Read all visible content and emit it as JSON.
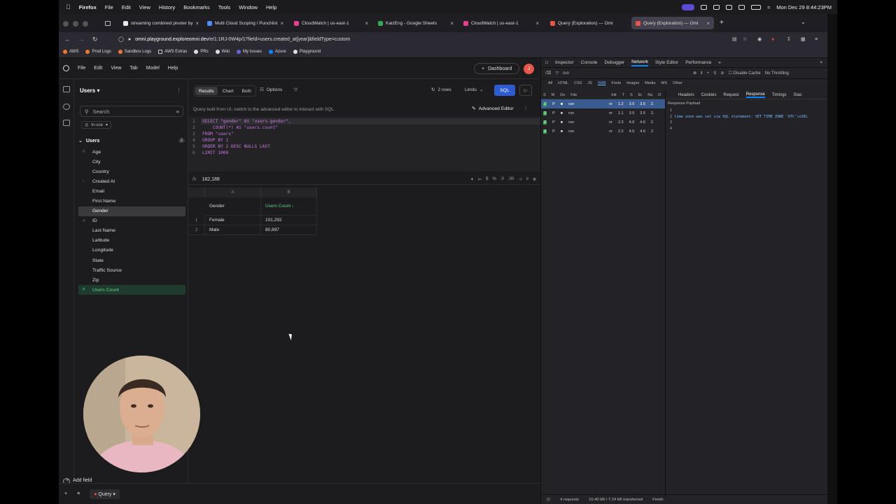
{
  "menubar": {
    "app": "Firefox",
    "menus": [
      "File",
      "Edit",
      "View",
      "History",
      "Bookmarks",
      "Tools",
      "Window",
      "Help"
    ],
    "clock": "Mon Dec 29  8:44:23PM"
  },
  "tabs": [
    {
      "label": "streaming combined pivoter by",
      "color": "#e8e8e8"
    },
    {
      "label": "Multi Cloud Scoping / Punchlist",
      "color": "#4f8ef7"
    },
    {
      "label": "CloudWatch | us-east-1",
      "color": "#e83e8c"
    },
    {
      "label": "KaizEng - Google Sheets",
      "color": "#34a853"
    },
    {
      "label": "CloudWatch | us-east-1",
      "color": "#e83e8c"
    },
    {
      "label": "Query (Exploration) — Omi",
      "color": "#e8554a"
    },
    {
      "label": "Query (Exploration) — Omi",
      "color": "#e8554a"
    }
  ],
  "url": {
    "host": "omni.playground.exploreomni.dev",
    "path": "/e/1:1RJ-0W4p/1?field=users.created_at[year]&fieldType=custom"
  },
  "bookmarks": [
    "AWS",
    "Prod Logs",
    "Sandbox Logs",
    "AWS Extras",
    "PRs",
    "Wiki",
    "My Issues",
    "Azure",
    "Playground"
  ],
  "app": {
    "menus": [
      "File",
      "Edit",
      "View",
      "Tab",
      "Model",
      "Help"
    ],
    "dashboard_label": "Dashboard",
    "avatar_initial": "J"
  },
  "sidebar": {
    "title": "Users",
    "search_placeholder": "Search",
    "filter_label": "In-use",
    "view_name": "Users",
    "view_count": "2",
    "fields": [
      {
        "label": "Age",
        "state": ""
      },
      {
        "label": "City",
        "state": ""
      },
      {
        "label": "Country",
        "state": ""
      },
      {
        "label": "Created At",
        "state": "group"
      },
      {
        "label": "Email",
        "state": ""
      },
      {
        "label": "First Name",
        "state": ""
      },
      {
        "label": "Gender",
        "state": "selected"
      },
      {
        "label": "ID",
        "state": ""
      },
      {
        "label": "Last Name",
        "state": ""
      },
      {
        "label": "Latitude",
        "state": ""
      },
      {
        "label": "Longitude",
        "state": ""
      },
      {
        "label": "State",
        "state": ""
      },
      {
        "label": "Traffic Source",
        "state": ""
      },
      {
        "label": "Zip",
        "state": ""
      },
      {
        "label": "Users Count",
        "state": "used"
      }
    ],
    "add_field_label": "Add field"
  },
  "toolbar": {
    "results": "Results",
    "chart": "Chart",
    "both": "Both",
    "options": "Options",
    "rows": "2 rows",
    "limits": "Limits",
    "sql": "SQL"
  },
  "info": {
    "message": "Query built from UI, switch to the advanced editor to interact with SQL.",
    "advanced_editor": "Advanced Editor"
  },
  "sql_lines": [
    "SELECT \"gender\" AS \"users.gender\",",
    "    COUNT(*) AS \"users.count\"",
    "FROM \"users\"",
    "GROUP BY 1",
    "ORDER BY 2 DESC NULLS LAST",
    "LIMIT 1000"
  ],
  "formula_bar": {
    "fx": "fx",
    "value": "182,188"
  },
  "grid": {
    "col_letters": [
      "A",
      "B"
    ],
    "headers": [
      "Gender",
      "Users Count ↓"
    ],
    "rows": [
      {
        "n": "1",
        "gender": "Female",
        "count": "101,292"
      },
      {
        "n": "2",
        "gender": "Male",
        "count": "80,897"
      }
    ]
  },
  "bottom_tab": "Query",
  "devtools": {
    "tabs": [
      "Inspector",
      "Console",
      "Debugger",
      "Network",
      "Style Editor",
      "Performance"
    ],
    "filter_value": "run",
    "disable_cache": "Disable Cache",
    "throttling": "No Throttling",
    "types": [
      "All",
      "HTML",
      "CSS",
      "JS",
      "XHR",
      "Fonts",
      "Images",
      "Media",
      "WS",
      "Other"
    ],
    "col_headers": [
      "S",
      "M",
      "Do",
      "File",
      "Init",
      "T",
      "S",
      "Er",
      "Ra",
      "D"
    ],
    "requests": [
      {
        "status": "P",
        "file": "run",
        "type": "nr",
        "size": "1.2",
        "tr": "3.5",
        "d": "3.5",
        "e": "2."
      },
      {
        "status": "P",
        "file": "run",
        "type": "nr",
        "size": "1.1",
        "tr": "3.5",
        "d": "3.5",
        "e": "2."
      },
      {
        "status": "P",
        "file": "run",
        "type": "nr",
        "size": "2.3",
        "tr": "4.6",
        "d": "4.6",
        "e": "2."
      },
      {
        "status": "P",
        "file": "run",
        "type": "nr",
        "size": "2.3",
        "tr": "4.6",
        "d": "4.6",
        "e": "2."
      }
    ],
    "resp_tabs": [
      "Headers",
      "Cookies",
      "Request",
      "Response",
      "Timings",
      "Stac"
    ],
    "payload_title": "Response Payload",
    "payload_lines": [
      {
        "n": "1",
        "text": ""
      },
      {
        "n": "2",
        "text": "time zone was set via SQL statement: SET TIME ZONE 'UTC'\\nSEL"
      },
      {
        "n": "3",
        "text": ""
      },
      {
        "n": "4",
        "text": ""
      }
    ],
    "status": {
      "requests": "4 requests",
      "transferred": "10.40 kB / 7.24 kB transferred",
      "finish": "Finish"
    }
  }
}
